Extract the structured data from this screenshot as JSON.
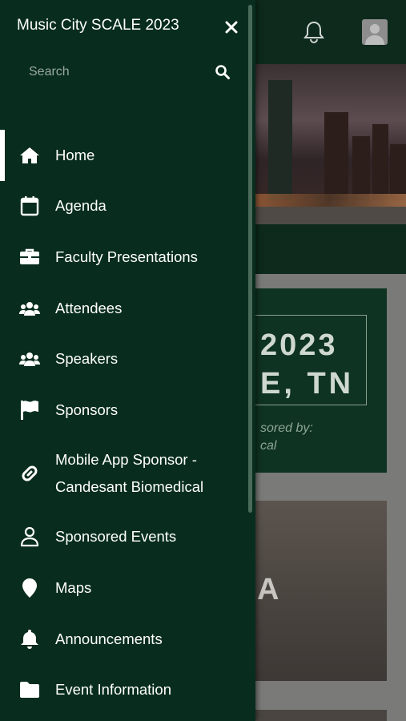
{
  "drawer": {
    "title": "Music City SCALE 2023",
    "search": {
      "placeholder": "Search",
      "value": ""
    },
    "items": [
      {
        "label": "Home",
        "icon": "home-icon",
        "active": true
      },
      {
        "label": "Agenda",
        "icon": "calendar-icon"
      },
      {
        "label": "Faculty Presentations",
        "icon": "briefcase-icon"
      },
      {
        "label": "Attendees",
        "icon": "users-icon"
      },
      {
        "label": "Speakers",
        "icon": "users-icon"
      },
      {
        "label": "Sponsors",
        "icon": "flag-icon"
      },
      {
        "label": "Mobile App Sponsor - Candesant Biomedical",
        "icon": "link-icon"
      },
      {
        "label": "Sponsored Events",
        "icon": "user-icon"
      },
      {
        "label": "Maps",
        "icon": "map-pin-icon"
      },
      {
        "label": "Announcements",
        "icon": "bell-icon"
      },
      {
        "label": "Event Information",
        "icon": "folder-icon"
      }
    ]
  },
  "background": {
    "card1_line1": "2023",
    "card1_line2": "E, TN",
    "card1_line3": "sored by:",
    "card1_line4": "cal",
    "card2_text": "A"
  },
  "colors": {
    "drawer": "#082d1e",
    "header": "#0d2a1c",
    "accent": "#ffffff"
  }
}
